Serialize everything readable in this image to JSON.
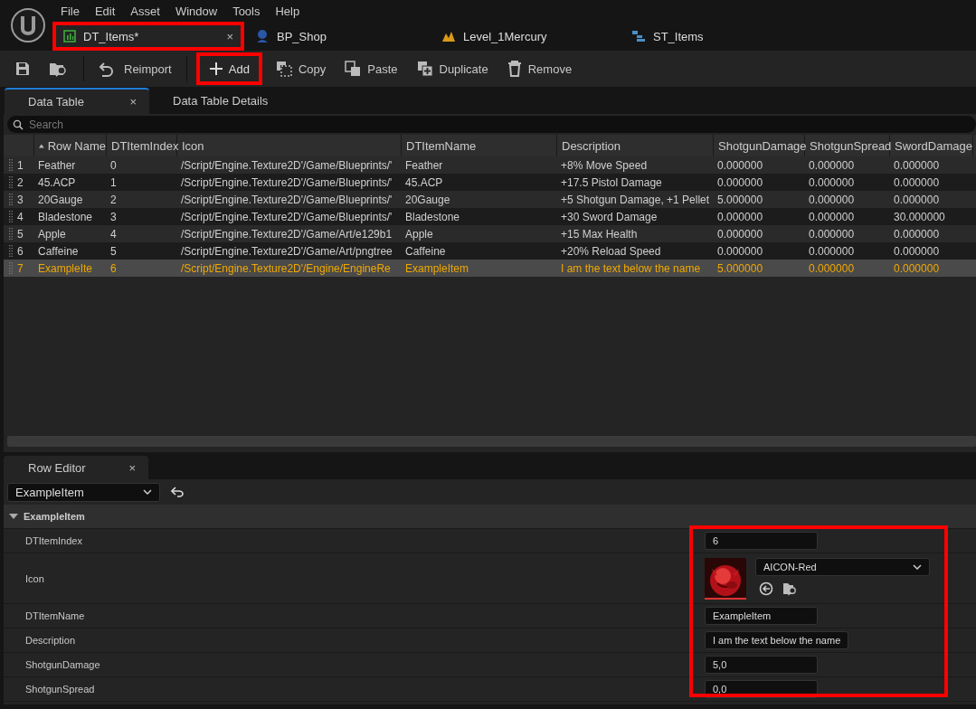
{
  "menu": [
    "File",
    "Edit",
    "Asset",
    "Window",
    "Tools",
    "Help"
  ],
  "document_tabs": [
    {
      "label": "DT_Items*",
      "selected": true,
      "highlighted": true,
      "close": "×"
    },
    {
      "label": "BP_Shop",
      "selected": false,
      "highlighted": false
    },
    {
      "label": "Level_1Mercury",
      "selected": false,
      "highlighted": false
    },
    {
      "label": "ST_Items",
      "selected": false,
      "highlighted": false
    }
  ],
  "toolbar": [
    {
      "highlighted": false
    },
    {
      "highlighted": false
    },
    {
      "label": "Reimport",
      "highlighted": false
    },
    {
      "label": "Add",
      "highlighted": true
    },
    {
      "label": "Copy",
      "highlighted": false
    },
    {
      "label": "Paste",
      "highlighted": false
    },
    {
      "label": "Duplicate",
      "highlighted": false
    },
    {
      "label": "Remove",
      "highlighted": false
    }
  ],
  "panel_tabs": [
    {
      "label": "Data Table",
      "selected": true,
      "close": "×"
    },
    {
      "label": "Data Table Details",
      "selected": false
    }
  ],
  "search": {
    "placeholder": "Search"
  },
  "table": {
    "columns": [
      {
        "label": "Row Name",
        "sorted": true
      },
      {
        "label": "DTItemIndex",
        "sorted": false
      },
      {
        "label": "Icon",
        "sorted": false
      },
      {
        "label": "DTItemName",
        "sorted": false
      },
      {
        "label": "Description",
        "sorted": false
      },
      {
        "label": "ShotgunDamage",
        "sorted": false
      },
      {
        "label": "ShotgunSpread",
        "sorted": false
      },
      {
        "label": "SwordDamage",
        "sorted": false
      }
    ],
    "rows": [
      {
        "number": "1",
        "selected": false,
        "cells": [
          "Feather",
          "0",
          "/Script/Engine.Texture2D'/Game/Blueprints/'",
          "Feather",
          "+8% Move Speed",
          "0.000000",
          "0.000000",
          "0.000000"
        ]
      },
      {
        "number": "2",
        "selected": false,
        "cells": [
          "45.ACP",
          "1",
          "/Script/Engine.Texture2D'/Game/Blueprints/'",
          "45.ACP",
          "+17.5 Pistol Damage",
          "0.000000",
          "0.000000",
          "0.000000"
        ]
      },
      {
        "number": "3",
        "selected": false,
        "cells": [
          "20Gauge",
          "2",
          "/Script/Engine.Texture2D'/Game/Blueprints/'",
          "20Gauge",
          "+5 Shotgun Damage, +1 Pellet",
          "5.000000",
          "0.000000",
          "0.000000"
        ]
      },
      {
        "number": "4",
        "selected": false,
        "cells": [
          "Bladestone",
          "3",
          "/Script/Engine.Texture2D'/Game/Blueprints/'",
          "Bladestone",
          "+30 Sword Damage",
          "0.000000",
          "0.000000",
          "30.000000"
        ]
      },
      {
        "number": "5",
        "selected": false,
        "cells": [
          "Apple",
          "4",
          "/Script/Engine.Texture2D'/Game/Art/e129b1",
          "Apple",
          "+15 Max Health",
          "0.000000",
          "0.000000",
          "0.000000"
        ]
      },
      {
        "number": "6",
        "selected": false,
        "cells": [
          "Caffeine",
          "5",
          "/Script/Engine.Texture2D'/Game/Art/pngtree",
          "Caffeine",
          "+20% Reload Speed",
          "0.000000",
          "0.000000",
          "0.000000"
        ]
      },
      {
        "number": "7",
        "selected": true,
        "cells": [
          "ExampleIte",
          "6",
          "/Script/Engine.Texture2D'/Engine/EngineRe",
          "ExampleItem",
          "I am the text below the name",
          "5.000000",
          "0.000000",
          "0.000000"
        ]
      }
    ]
  },
  "row_editor": {
    "tab": {
      "label": "Row Editor",
      "close": "×"
    },
    "row_select": "ExampleItem",
    "highlighted": true,
    "category": {
      "label": "ExampleItem",
      "expanded": true
    },
    "properties": [
      {
        "name": "DTItemIndex",
        "kind": "text",
        "value": "6"
      },
      {
        "name": "Icon",
        "kind": "asset",
        "value": "AICON-Red"
      },
      {
        "name": "DTItemName",
        "kind": "text",
        "value": "ExampleItem"
      },
      {
        "name": "Description",
        "kind": "text",
        "value": "I am the text below the name"
      },
      {
        "name": "ShotgunDamage",
        "kind": "text",
        "value": "5,0"
      },
      {
        "name": "ShotgunSpread",
        "kind": "text",
        "value": "0,0"
      }
    ]
  }
}
